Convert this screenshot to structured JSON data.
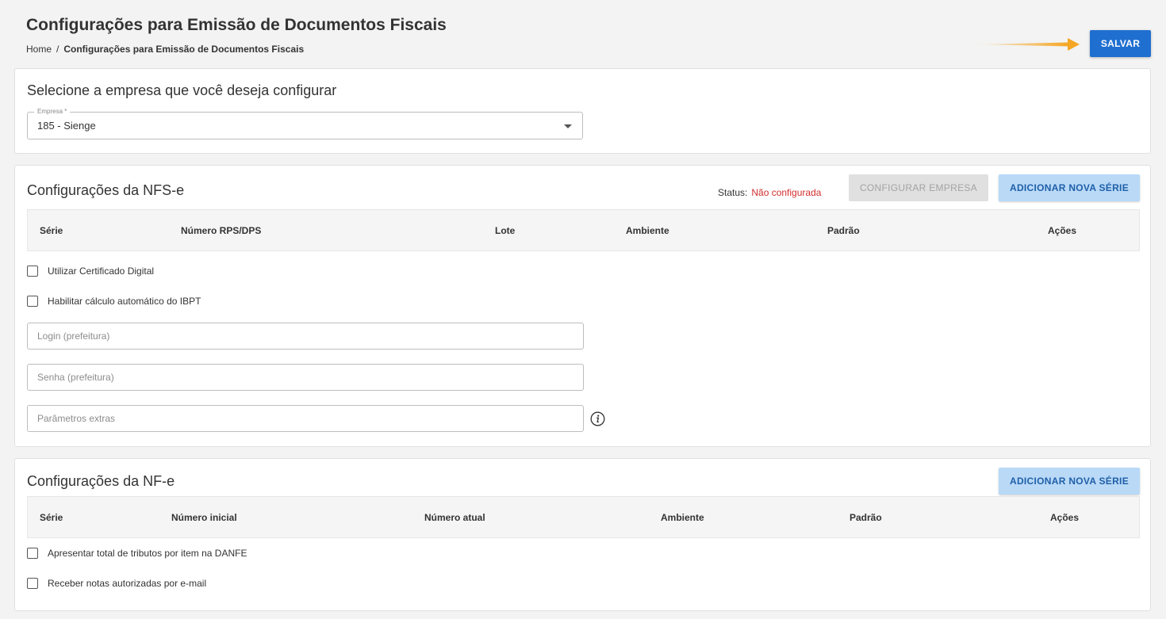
{
  "header": {
    "title": "Configurações para Emissão de Documentos Fiscais",
    "breadcrumb": {
      "home": "Home",
      "separator": "/",
      "current": "Configurações para Emissão de Documentos Fiscais"
    },
    "save_label": "SALVAR",
    "accent_color": "#1f6fd0",
    "arrow_color": "#f5a623"
  },
  "company": {
    "title": "Selecione a empresa que você deseja configurar",
    "select_label": "Empresa *",
    "select_value": "185 - Sienge"
  },
  "nfse": {
    "title": "Configurações da NFS-e",
    "status_label": "Status:",
    "status_value": "Não configurada",
    "configure_label": "CONFIGURAR EMPRESA",
    "add_series_label": "ADICIONAR NOVA SÉRIE",
    "columns": [
      "Série",
      "Número RPS/DPS",
      "Lote",
      "Ambiente",
      "Padrão",
      "Ações"
    ],
    "checkboxes": [
      "Utilizar Certificado Digital",
      "Habilitar cálculo automático do IBPT"
    ],
    "login_placeholder": "Login (prefeitura)",
    "password_placeholder": "Senha (prefeitura)",
    "extra_placeholder": "Parâmetros extras"
  },
  "nfe": {
    "title": "Configurações da NF-e",
    "add_series_label": "ADICIONAR NOVA SÉRIE",
    "columns": [
      "Série",
      "Número inicial",
      "Número atual",
      "Ambiente",
      "Padrão",
      "Ações"
    ],
    "checkboxes": [
      "Apresentar total de tributos por item na DANFE",
      "Receber notas autorizadas por e-mail"
    ]
  }
}
